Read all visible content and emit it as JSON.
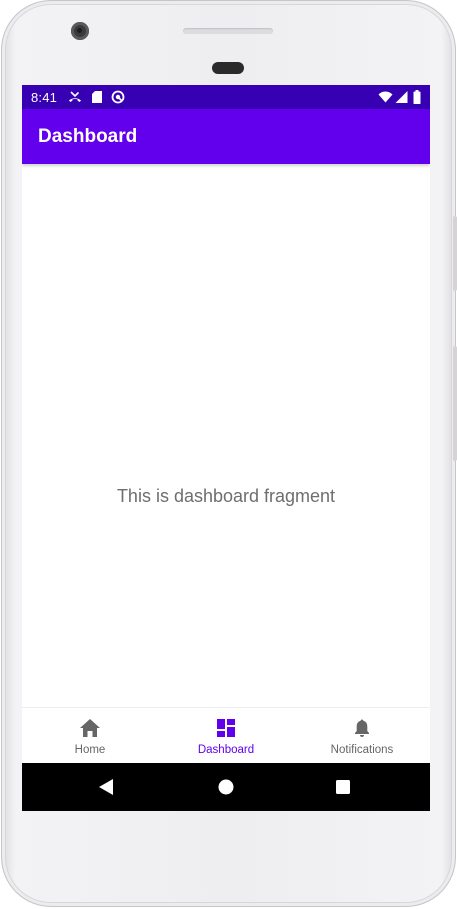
{
  "status_bar": {
    "time": "8:41",
    "left_icons": [
      "missed-call-icon",
      "sd-card-icon",
      "sync-icon"
    ],
    "right_icons": [
      "wifi-icon",
      "signal-icon",
      "battery-icon"
    ],
    "background": "#3700b3"
  },
  "app_bar": {
    "title": "Dashboard",
    "background": "#6200ee"
  },
  "content": {
    "text": "This is dashboard fragment"
  },
  "bottom_nav": {
    "items": [
      {
        "label": "Home",
        "icon": "home-icon",
        "selected": false
      },
      {
        "label": "Dashboard",
        "icon": "dashboard-icon",
        "selected": true
      },
      {
        "label": "Notifications",
        "icon": "bell-icon",
        "selected": false
      }
    ],
    "active_color": "#6200ee",
    "inactive_color": "#666666"
  },
  "system_nav": {
    "buttons": [
      "back-icon",
      "home-circle-icon",
      "recents-icon"
    ]
  }
}
